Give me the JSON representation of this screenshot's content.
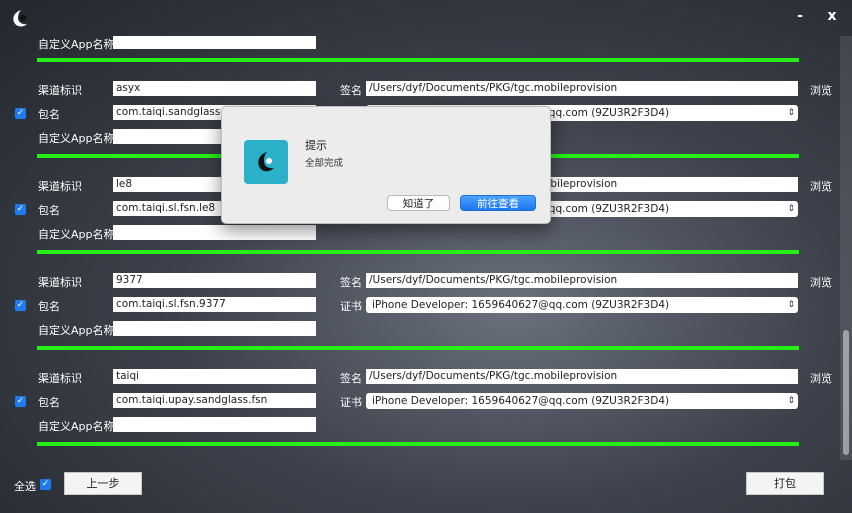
{
  "window": {
    "minimize_glyph": "-",
    "close_glyph": "x"
  },
  "labels": {
    "channel": "渠道标识",
    "package": "包名",
    "custom_app_name": "自定义App名称",
    "signature": "签名",
    "certificate": "证书",
    "browse": "浏览"
  },
  "rows": [
    {
      "channel": "asyx",
      "package": "com.taiqi.sandglass.fsn",
      "custom_app_name": "",
      "signature": "/Users/dyf/Documents/PKG/tgc.mobileprovision",
      "certificate": "iPhone Developer: 1659640627@qq.com (9ZU3R2F3D4)",
      "checked": true
    },
    {
      "channel": "le8",
      "package": "com.taiqi.sl.fsn.le8",
      "custom_app_name": "",
      "signature": "/Users/dyf/Documents/PKG/tgc.mobileprovision",
      "certificate": "iPhone Developer: 1659640627@qq.com (9ZU3R2F3D4)",
      "checked": true
    },
    {
      "channel": "9377",
      "package": "com.taiqi.sl.fsn.9377",
      "custom_app_name": "",
      "signature": "/Users/dyf/Documents/PKG/tgc.mobileprovision",
      "certificate": "iPhone Developer: 1659640627@qq.com (9ZU3R2F3D4)",
      "checked": true
    },
    {
      "channel": "taiqi",
      "package": "com.taiqi.upay.sandglass.fsn",
      "custom_app_name": "",
      "signature": "/Users/dyf/Documents/PKG/tgc.mobileprovision",
      "certificate": "iPhone Developer: 1659640627@qq.com (9ZU3R2F3D4)",
      "checked": true
    }
  ],
  "footer": {
    "select_all": "全选",
    "select_all_checked": true,
    "prev_button": "上一步",
    "pack_button": "打包"
  },
  "dialog": {
    "title": "提示",
    "message": "全部完成",
    "secondary_button": "知道了",
    "primary_button": "前往查看"
  },
  "colors": {
    "accent_blue": "#1f7bf2",
    "separator_green": "#26ef17",
    "dialog_icon_bg": "#2ab0c9"
  }
}
